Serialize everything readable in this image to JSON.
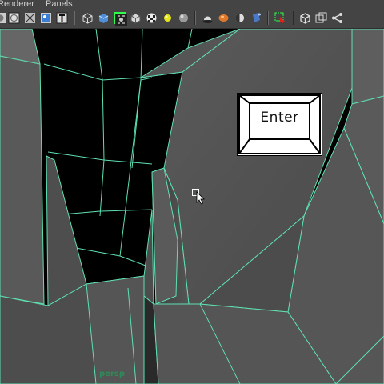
{
  "menubar": {
    "items": [
      "Renderer",
      "Panels"
    ]
  },
  "toolbar": {
    "icons": [
      "shading-icon",
      "wireframe-icon",
      "xray-icon",
      "textured-icon",
      "text-icon",
      "wireframe-cube-icon",
      "smooth-shade-icon",
      "isolate-icon",
      "default-material-icon",
      "checker-icon",
      "light-icon",
      "sphere-icon",
      "shadow-icon",
      "material-ball-icon",
      "half-sphere-icon",
      "cylinder-icon",
      "select-highlight-icon",
      "camera-cube-icon",
      "frame-icon",
      "share-icon"
    ]
  },
  "viewport": {
    "camera_label": "persp"
  },
  "key_overlay": {
    "label": "Enter"
  },
  "colors": {
    "wire": "#5fe0b0",
    "ui_bg": "#444444",
    "mesh_dark": "#4a4a4a",
    "mesh_light": "#6a6a6a"
  }
}
